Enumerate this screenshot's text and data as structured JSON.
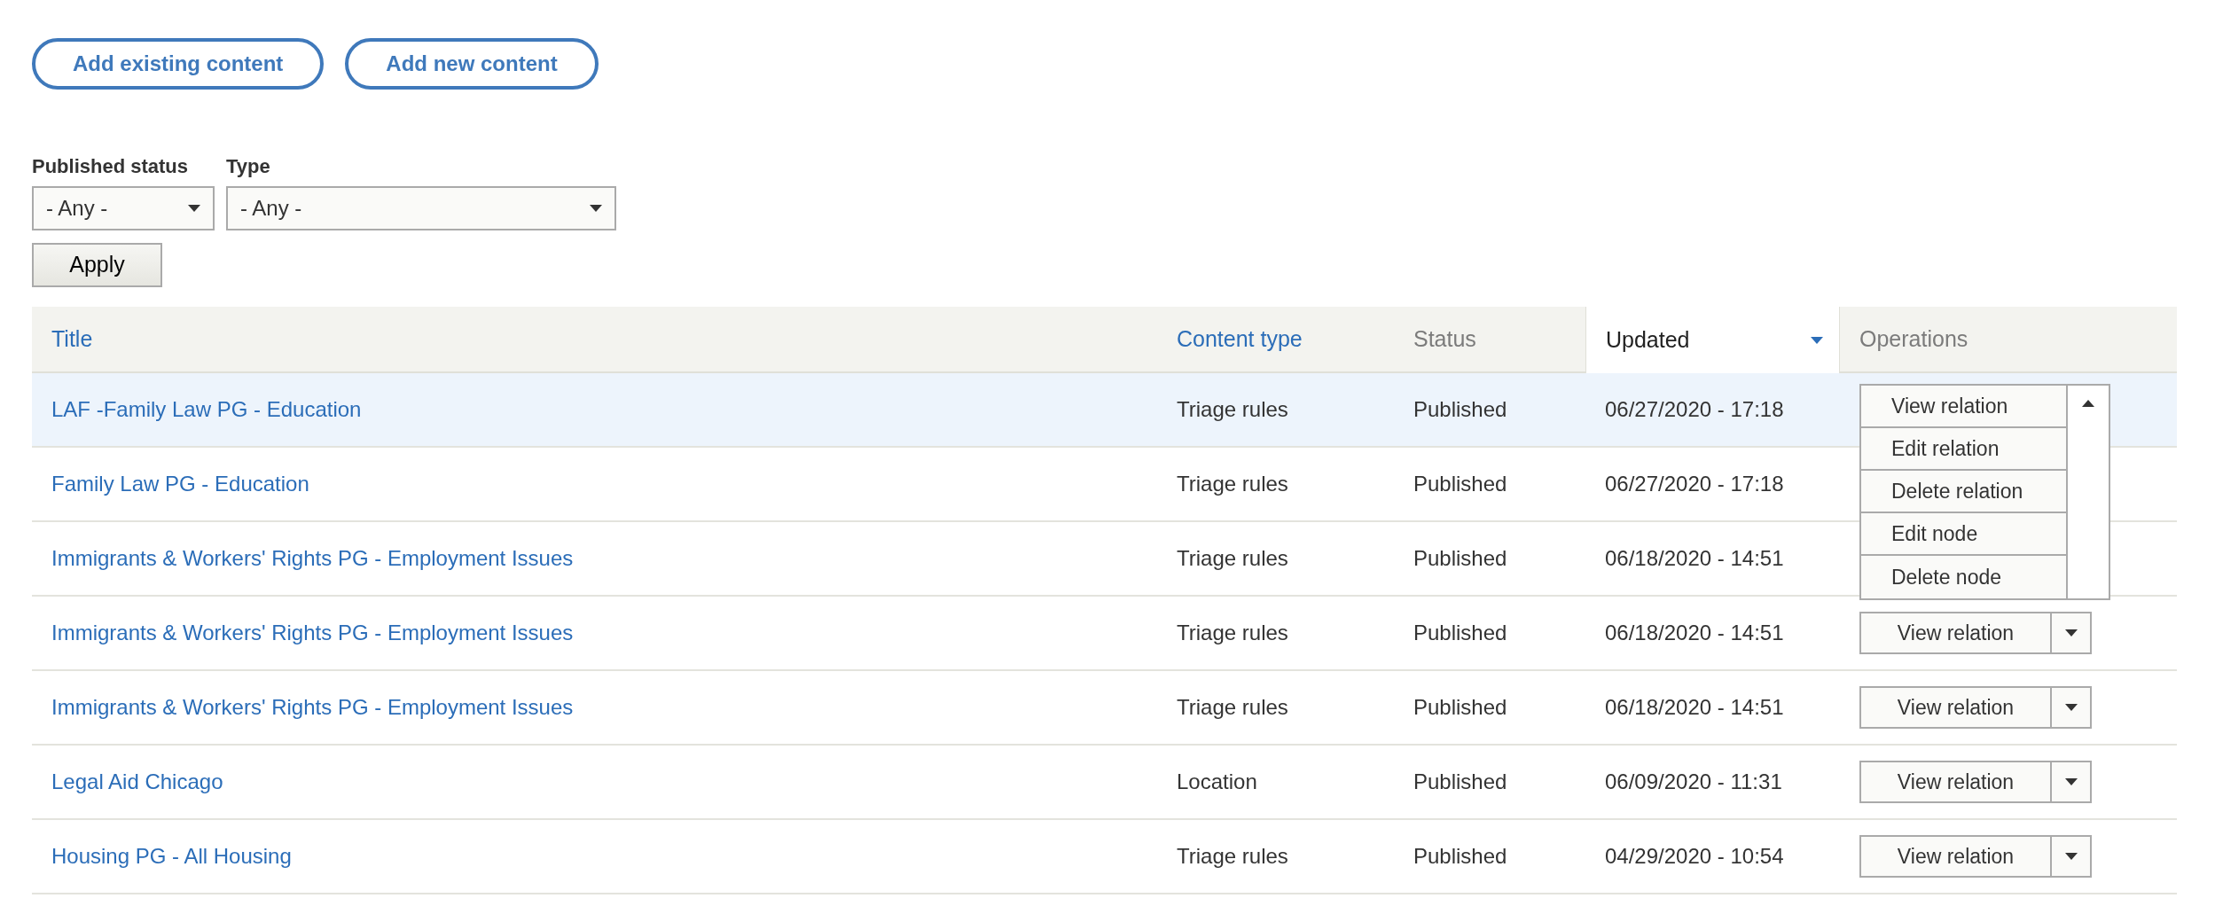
{
  "actions": [
    "Add existing content",
    "Add new content"
  ],
  "filters": [
    {
      "label": "Published status",
      "value": "- Any -"
    },
    {
      "label": "Type",
      "value": "- Any -"
    }
  ],
  "apply_button": "Apply",
  "table": {
    "columns": [
      {
        "label": "Title",
        "sortable": true,
        "selected": false
      },
      {
        "label": "Content type",
        "sortable": true,
        "selected": false
      },
      {
        "label": "Status",
        "sortable": false,
        "selected": false
      },
      {
        "label": "Updated",
        "sortable": true,
        "selected": true
      },
      {
        "label": "Operations",
        "sortable": false,
        "selected": false
      }
    ],
    "rows": [
      {
        "title": "LAF -Family Law PG - Education",
        "content_type": "Triage rules",
        "status": "Published",
        "updated": "06/27/2020 - 17:18",
        "selected": true,
        "operations": {
          "label": "View relation",
          "expanded": true,
          "menu": [
            "Edit relation",
            "Delete relation",
            "Edit node",
            "Delete node"
          ]
        }
      },
      {
        "title": "Family Law PG - Education",
        "content_type": "Triage rules",
        "status": "Published",
        "updated": "06/27/2020 - 17:18",
        "selected": false
      },
      {
        "title": "Immigrants & Workers' Rights PG - Employment Issues",
        "content_type": "Triage rules",
        "status": "Published",
        "updated": "06/18/2020 - 14:51",
        "selected": false
      },
      {
        "title": "Immigrants & Workers' Rights PG - Employment Issues",
        "content_type": "Triage rules",
        "status": "Published",
        "updated": "06/18/2020 - 14:51",
        "selected": false,
        "operations": {
          "label": "View relation",
          "expanded": false
        }
      },
      {
        "title": "Immigrants & Workers' Rights PG - Employment Issues",
        "content_type": "Triage rules",
        "status": "Published",
        "updated": "06/18/2020 - 14:51",
        "selected": false,
        "operations": {
          "label": "View relation",
          "expanded": false
        }
      },
      {
        "title": "Legal Aid Chicago",
        "content_type": "Location",
        "status": "Published",
        "updated": "06/09/2020 - 11:31",
        "selected": false,
        "operations": {
          "label": "View relation",
          "expanded": false
        }
      },
      {
        "title": "Housing PG - All Housing",
        "content_type": "Triage rules",
        "status": "Published",
        "updated": "04/29/2020 - 10:54",
        "selected": false,
        "operations": {
          "label": "View relation",
          "expanded": false
        }
      }
    ]
  }
}
